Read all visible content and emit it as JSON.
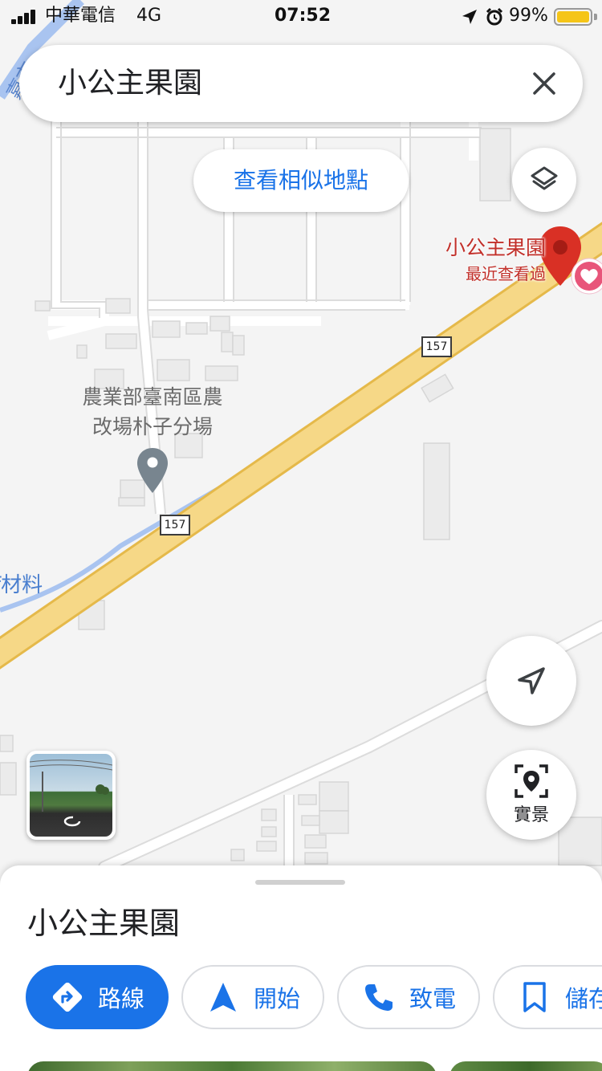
{
  "status_bar": {
    "carrier": "中華電信",
    "network": "4G",
    "time": "07:52",
    "battery": "99%",
    "battery_level": 0.99
  },
  "search": {
    "query": "小公主果園",
    "close_icon": "close-icon"
  },
  "map": {
    "similar_places_label": "查看相似地點",
    "layers_icon": "layers-icon",
    "poi_name_line1": "農業部臺南區農",
    "poi_name_line2": "改場朴子分場",
    "edge_label": "f材料",
    "city_label": "嘉市",
    "route_shield_1": "157",
    "route_shield_2": "157",
    "selected_place": {
      "name": "小公主果園",
      "subtitle": "最近查看過"
    }
  },
  "controls": {
    "my_location_icon": "navigation-arrow-icon",
    "live_view_label": "實景",
    "live_view_icon": "live-view-icon"
  },
  "sheet": {
    "title": "小公主果園",
    "actions": {
      "directions": "路線",
      "start": "開始",
      "call": "致電",
      "save": "儲存"
    }
  },
  "colors": {
    "accent": "#1a73e8",
    "road_highway": "#f6d887",
    "pin_red": "#d93025",
    "favorite_pink": "#e8557a"
  }
}
